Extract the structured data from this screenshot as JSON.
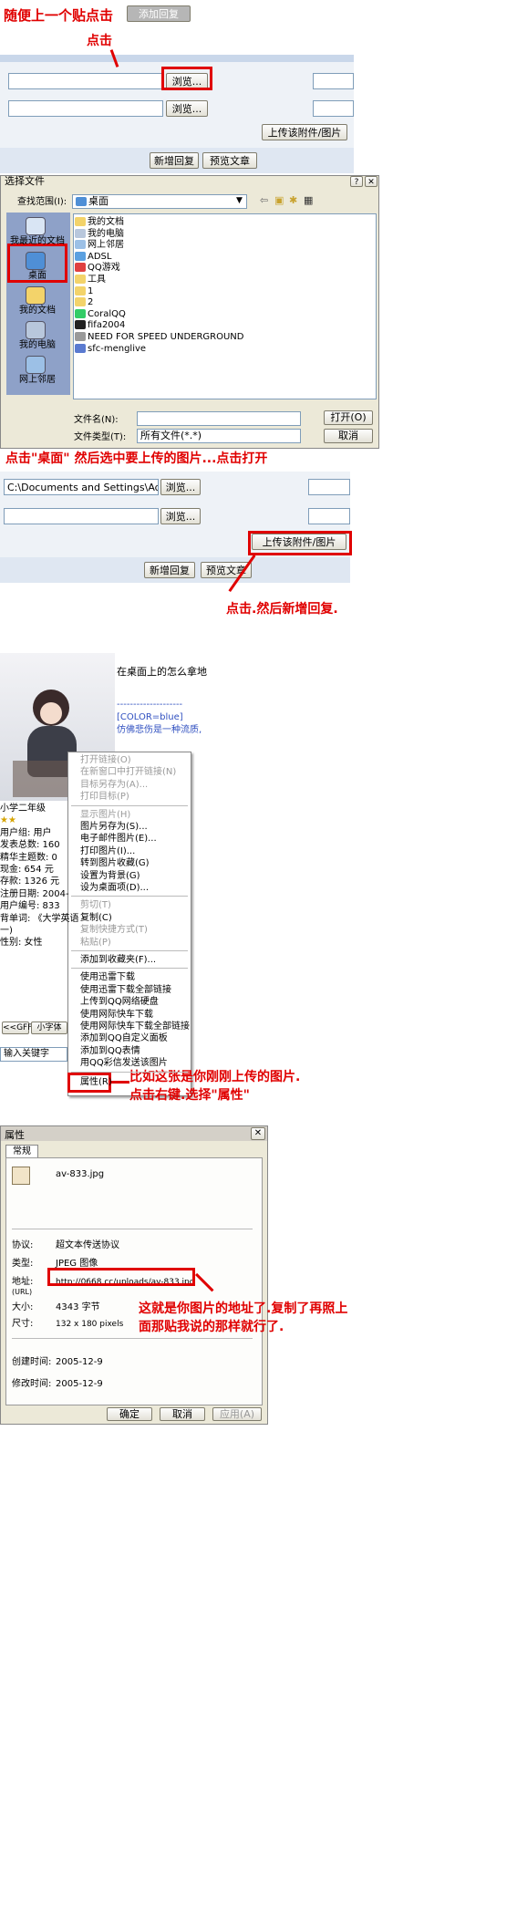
{
  "section1": {
    "instruction": "随便上一个贴点击",
    "add_reply_img_label": "添加回复",
    "click_note": "点击",
    "browse_label": "浏览...",
    "browse_label2": "浏览...",
    "upload_label": "上传该附件/图片",
    "new_reply_label": "新增回复",
    "preview_label": "预览文章"
  },
  "dialog": {
    "title": "选择文件",
    "lookin_label": "查找范围(I):",
    "lookin_value": "桌面",
    "places": [
      "我最近的文档",
      "桌面",
      "我的文档",
      "我的电脑",
      "网上邻居"
    ],
    "files": [
      "我的文档",
      "我的电脑",
      "网上邻居",
      "ADSL",
      "QQ游戏",
      "工具",
      "1",
      "2",
      "CoralQQ",
      "fifa2004",
      "NEED FOR SPEED UNDERGROUND",
      "sfc-menglive"
    ],
    "filename_label": "文件名(N):",
    "filetype_label": "文件类型(T):",
    "filetype_value": "所有文件(*.*)",
    "open_label": "打开(O)",
    "cancel_label": "取消"
  },
  "note2": "点击\"桌面\" 然后选中要上传的图片...点击打开",
  "section3": {
    "path_value": "C:\\Documents and Settings\\Adminis",
    "browse_label": "浏览...",
    "browse_label2": "浏览...",
    "upload_label": "上传该附件/图片",
    "new_reply_label": "新增回复",
    "preview_label": "预览文章",
    "note": "点击.然后新增回复."
  },
  "section4": {
    "post_line1": "在桌面上的怎么拿地",
    "post_dashes": "--------------------",
    "post_color": "[COLOR=blue]",
    "post_line2": "仿佛悲伤是一种流质,",
    "user_info": [
      "小学二年级",
      "★★",
      "用户组: 用户",
      "发表总数: 160",
      "精华主题数: 0",
      "现金: 654 元",
      "存款: 1326 元",
      "注册日期: 2004-",
      "用户编号: 833",
      "背单词: 《大学英语",
      "一)",
      "性别: 女性"
    ],
    "btn_a": "<<GFF",
    "btn_b": "小字体",
    "search_placeholder": "输入关键字",
    "menu_groups": [
      {
        "items": [
          {
            "t": "打开链接(O)",
            "d": true
          },
          {
            "t": "在新窗口中打开链接(N)",
            "d": true
          },
          {
            "t": "目标另存为(A)...",
            "d": true
          },
          {
            "t": "打印目标(P)",
            "d": true
          }
        ]
      },
      {
        "items": [
          {
            "t": "显示图片(H)",
            "d": true
          },
          {
            "t": "图片另存为(S)...",
            "d": false
          },
          {
            "t": "电子邮件图片(E)...",
            "d": false
          },
          {
            "t": "打印图片(I)...",
            "d": false
          },
          {
            "t": "转到图片收藏(G)",
            "d": false
          },
          {
            "t": "设置为背景(G)",
            "d": false
          },
          {
            "t": "设为桌面项(D)...",
            "d": false
          }
        ]
      },
      {
        "items": [
          {
            "t": "剪切(T)",
            "d": true
          },
          {
            "t": "复制(C)",
            "d": false
          },
          {
            "t": "复制快捷方式(T)",
            "d": true
          },
          {
            "t": "粘贴(P)",
            "d": true
          }
        ]
      },
      {
        "items": [
          {
            "t": "添加到收藏夹(F)...",
            "d": false
          }
        ]
      },
      {
        "items": [
          {
            "t": "使用迅雷下载",
            "d": false
          },
          {
            "t": "使用迅雷下载全部链接",
            "d": false
          },
          {
            "t": "上传到QQ网络硬盘",
            "d": false
          },
          {
            "t": "使用网际快车下载",
            "d": false
          },
          {
            "t": "使用网际快车下载全部链接",
            "d": false
          },
          {
            "t": "添加到QQ自定义面板",
            "d": false
          },
          {
            "t": "添加到QQ表情",
            "d": false
          },
          {
            "t": "用QQ彩信发送该图片",
            "d": false
          }
        ]
      }
    ],
    "properties_item": "属性(R)",
    "note_line1": "比如这张是你刚刚上传的图片.",
    "note_line2": "点击右键.选择\"属性\""
  },
  "props": {
    "title": "属性",
    "tab": "常规",
    "filename": "av-833.jpg",
    "protocol_label": "协议:",
    "protocol_value": "超文本传送协议",
    "type_label": "类型:",
    "type_value": "JPEG 图像",
    "address_label": "地址:",
    "address_sub": "(URL)",
    "address_value": "http://0668.cc/uploads/av-833.jpg",
    "size_label": "大小:",
    "size_value": "4343 字节",
    "dims_label": "尺寸:",
    "dims_value": "132  x  180  pixels",
    "created_label": "创建时间:",
    "created_value": "2005-12-9",
    "modified_label": "修改时间:",
    "modified_value": "2005-12-9",
    "ok_label": "确定",
    "cancel_label": "取消",
    "apply_label": "应用(A)",
    "note_line1": "这就是你图片的地址了.复制了再照上",
    "note_line2": "面那贴我说的那样就行了."
  }
}
